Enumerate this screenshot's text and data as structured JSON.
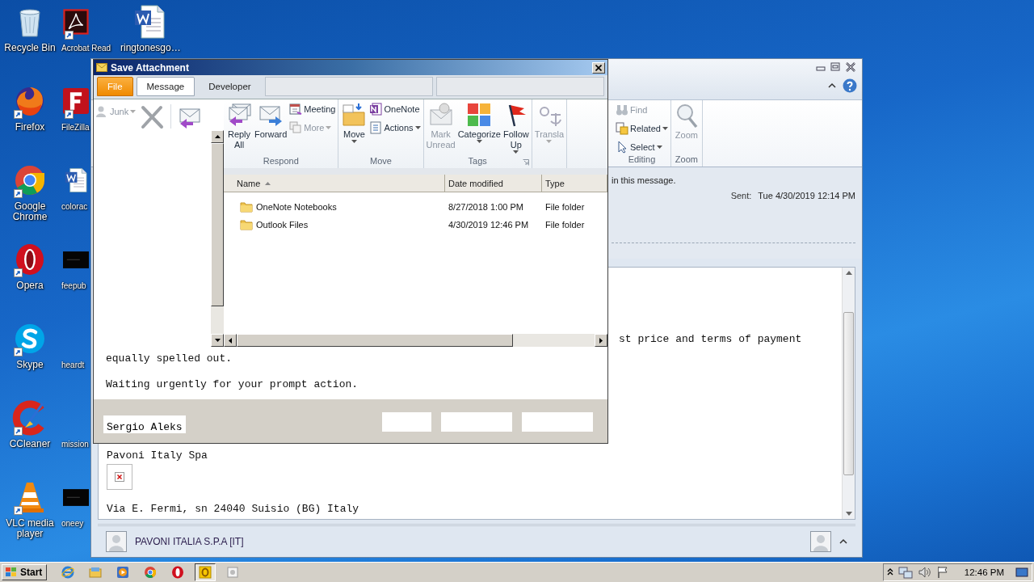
{
  "desktop_icons": [
    {
      "label": "Recycle Bin",
      "kind": "recycle",
      "shortcut": false
    },
    {
      "label": "Firefox",
      "kind": "firefox",
      "shortcut": true
    },
    {
      "label": "Google Chrome",
      "kind": "chrome",
      "shortcut": true
    },
    {
      "label": "Opera",
      "kind": "opera",
      "shortcut": true
    },
    {
      "label": "Skype",
      "kind": "skype",
      "shortcut": true
    },
    {
      "label": "CCleaner",
      "kind": "ccleaner",
      "shortcut": true
    },
    {
      "label": "VLC media player",
      "kind": "vlc",
      "shortcut": true
    },
    {
      "label": "Acrobat Read",
      "kind": "acrobat",
      "shortcut": true
    },
    {
      "label": "FileZilla",
      "kind": "filezilla",
      "shortcut": true
    },
    {
      "label": "colorac",
      "kind": "word",
      "shortcut": false
    },
    {
      "label": "feepub",
      "kind": "thumb",
      "shortcut": false
    },
    {
      "label": "heardt",
      "kind": "blank",
      "shortcut": false
    },
    {
      "label": "mission",
      "kind": "blank",
      "shortcut": false
    },
    {
      "label": "oneey",
      "kind": "thumb",
      "shortcut": false
    },
    {
      "label": "ringtonesgo…",
      "kind": "word",
      "shortcut": false
    }
  ],
  "outlook_window": {
    "ribbon_groups": [
      {
        "label": "Editing",
        "items": [
          {
            "label": "Find",
            "kind": "find",
            "disabled": true,
            "dropdown": false
          },
          {
            "label": "Related",
            "kind": "related",
            "disabled": false,
            "dropdown": true
          },
          {
            "label": "Select",
            "kind": "select",
            "disabled": false,
            "dropdown": true
          }
        ]
      },
      {
        "label": "Zoom",
        "items": [
          {
            "label": "Zoom",
            "kind": "zoom",
            "disabled": true,
            "dropdown": false
          }
        ]
      }
    ],
    "info_bar": "in this message.",
    "sent_label": "Sent:",
    "sent_value": "Tue 4/30/2019 12:14 PM",
    "body_fragment": "st price and terms of payment",
    "signature": [
      {
        "kind": "text",
        "text": "Pavoni Italy Spa"
      },
      {
        "kind": "image"
      },
      {
        "kind": "text",
        "text": "Via E. Fermi, sn 24040 Suisio (BG) Italy"
      }
    ],
    "people_pane": {
      "name": "PAVONI ITALIA S.P.A [IT]"
    }
  },
  "save_attachment_dialog": {
    "title": "Save Attachment",
    "tabs": [
      {
        "label": "File",
        "kind": "file",
        "selected": false
      },
      {
        "label": "Message",
        "kind": "tab",
        "selected": true
      },
      {
        "label": "Developer",
        "kind": "tab",
        "selected": false
      }
    ],
    "left_tools": [
      {
        "label": "Junk",
        "kind": "junk",
        "disabled": true,
        "dropdown": true
      },
      {
        "kind": "delete",
        "disabled": true
      },
      {
        "kind": "reply",
        "disabled": false
      }
    ],
    "ribbon_groups": [
      {
        "label": "Respond",
        "launcher": false,
        "items": [
          {
            "label": "Reply All",
            "kind": "reply-all",
            "disabled": false,
            "dropdown": false
          },
          {
            "label": "Forward",
            "kind": "forward",
            "disabled": false,
            "dropdown": false
          },
          {
            "label": "Meeting",
            "kind": "meeting",
            "disabled": false,
            "dropdown": false
          },
          {
            "label": "More",
            "kind": "more",
            "disabled": true,
            "dropdown": true
          }
        ]
      },
      {
        "label": "Move",
        "launcher": false,
        "items": [
          {
            "label": "Move",
            "kind": "move",
            "disabled": false,
            "dropdown": true
          },
          {
            "label": "OneNote",
            "kind": "onenote",
            "disabled": false,
            "dropdown": false
          },
          {
            "label": "Actions",
            "kind": "actions",
            "disabled": false,
            "dropdown": true
          }
        ]
      },
      {
        "label": "Tags",
        "launcher": true,
        "items": [
          {
            "label": "Mark Unread",
            "kind": "mark-unread",
            "disabled": true,
            "dropdown": false
          },
          {
            "label": "Categorize",
            "kind": "categorize",
            "disabled": false,
            "dropdown": true
          },
          {
            "label": "Follow Up",
            "kind": "follow-up",
            "disabled": false,
            "dropdown": true
          }
        ]
      },
      {
        "launcher": false,
        "items": [
          {
            "label": "Transla",
            "kind": "translate",
            "disabled": true,
            "dropdown": true
          }
        ]
      }
    ],
    "file_list": {
      "columns": [
        {
          "label": "Name",
          "sorted": true
        },
        {
          "label": "Date modified",
          "sorted": false
        },
        {
          "label": "Type",
          "sorted": false
        }
      ],
      "rows": [
        {
          "name": "OneNote Notebooks",
          "date": "8/27/2018 1:00 PM",
          "type": "File folder"
        },
        {
          "name": "Outlook Files",
          "date": "4/30/2019 12:46 PM",
          "type": "File folder"
        }
      ]
    },
    "message_lines": [
      "equally spelled out.",
      "Waiting urgently for your prompt action."
    ],
    "signature": "Sergio Aleks"
  },
  "taskbar": {
    "start_label": "Start",
    "apps": [
      {
        "kind": "ie",
        "selected": false
      },
      {
        "kind": "explorer",
        "selected": false
      },
      {
        "kind": "media",
        "selected": false
      },
      {
        "kind": "chrome",
        "selected": false
      },
      {
        "kind": "opera",
        "selected": false
      },
      {
        "kind": "outlook",
        "selected": true
      },
      {
        "kind": "app",
        "selected": false
      }
    ],
    "clock": "12:46 PM"
  }
}
